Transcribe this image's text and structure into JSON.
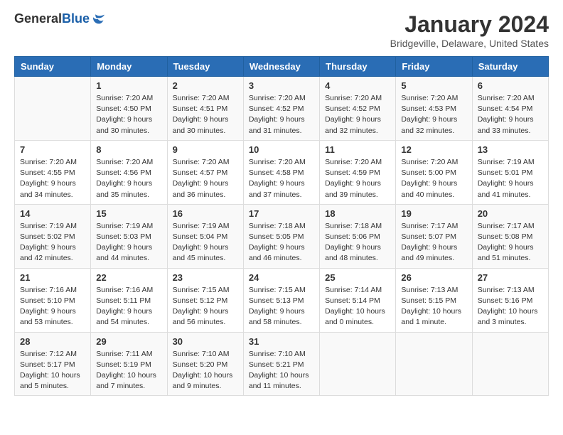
{
  "header": {
    "logo_general": "General",
    "logo_blue": "Blue",
    "month_title": "January 2024",
    "location": "Bridgeville, Delaware, United States"
  },
  "weekdays": [
    "Sunday",
    "Monday",
    "Tuesday",
    "Wednesday",
    "Thursday",
    "Friday",
    "Saturday"
  ],
  "weeks": [
    [
      {
        "day": "",
        "info": ""
      },
      {
        "day": "1",
        "info": "Sunrise: 7:20 AM\nSunset: 4:50 PM\nDaylight: 9 hours\nand 30 minutes."
      },
      {
        "day": "2",
        "info": "Sunrise: 7:20 AM\nSunset: 4:51 PM\nDaylight: 9 hours\nand 30 minutes."
      },
      {
        "day": "3",
        "info": "Sunrise: 7:20 AM\nSunset: 4:52 PM\nDaylight: 9 hours\nand 31 minutes."
      },
      {
        "day": "4",
        "info": "Sunrise: 7:20 AM\nSunset: 4:52 PM\nDaylight: 9 hours\nand 32 minutes."
      },
      {
        "day": "5",
        "info": "Sunrise: 7:20 AM\nSunset: 4:53 PM\nDaylight: 9 hours\nand 32 minutes."
      },
      {
        "day": "6",
        "info": "Sunrise: 7:20 AM\nSunset: 4:54 PM\nDaylight: 9 hours\nand 33 minutes."
      }
    ],
    [
      {
        "day": "7",
        "info": "Sunrise: 7:20 AM\nSunset: 4:55 PM\nDaylight: 9 hours\nand 34 minutes."
      },
      {
        "day": "8",
        "info": "Sunrise: 7:20 AM\nSunset: 4:56 PM\nDaylight: 9 hours\nand 35 minutes."
      },
      {
        "day": "9",
        "info": "Sunrise: 7:20 AM\nSunset: 4:57 PM\nDaylight: 9 hours\nand 36 minutes."
      },
      {
        "day": "10",
        "info": "Sunrise: 7:20 AM\nSunset: 4:58 PM\nDaylight: 9 hours\nand 37 minutes."
      },
      {
        "day": "11",
        "info": "Sunrise: 7:20 AM\nSunset: 4:59 PM\nDaylight: 9 hours\nand 39 minutes."
      },
      {
        "day": "12",
        "info": "Sunrise: 7:20 AM\nSunset: 5:00 PM\nDaylight: 9 hours\nand 40 minutes."
      },
      {
        "day": "13",
        "info": "Sunrise: 7:19 AM\nSunset: 5:01 PM\nDaylight: 9 hours\nand 41 minutes."
      }
    ],
    [
      {
        "day": "14",
        "info": "Sunrise: 7:19 AM\nSunset: 5:02 PM\nDaylight: 9 hours\nand 42 minutes."
      },
      {
        "day": "15",
        "info": "Sunrise: 7:19 AM\nSunset: 5:03 PM\nDaylight: 9 hours\nand 44 minutes."
      },
      {
        "day": "16",
        "info": "Sunrise: 7:19 AM\nSunset: 5:04 PM\nDaylight: 9 hours\nand 45 minutes."
      },
      {
        "day": "17",
        "info": "Sunrise: 7:18 AM\nSunset: 5:05 PM\nDaylight: 9 hours\nand 46 minutes."
      },
      {
        "day": "18",
        "info": "Sunrise: 7:18 AM\nSunset: 5:06 PM\nDaylight: 9 hours\nand 48 minutes."
      },
      {
        "day": "19",
        "info": "Sunrise: 7:17 AM\nSunset: 5:07 PM\nDaylight: 9 hours\nand 49 minutes."
      },
      {
        "day": "20",
        "info": "Sunrise: 7:17 AM\nSunset: 5:08 PM\nDaylight: 9 hours\nand 51 minutes."
      }
    ],
    [
      {
        "day": "21",
        "info": "Sunrise: 7:16 AM\nSunset: 5:10 PM\nDaylight: 9 hours\nand 53 minutes."
      },
      {
        "day": "22",
        "info": "Sunrise: 7:16 AM\nSunset: 5:11 PM\nDaylight: 9 hours\nand 54 minutes."
      },
      {
        "day": "23",
        "info": "Sunrise: 7:15 AM\nSunset: 5:12 PM\nDaylight: 9 hours\nand 56 minutes."
      },
      {
        "day": "24",
        "info": "Sunrise: 7:15 AM\nSunset: 5:13 PM\nDaylight: 9 hours\nand 58 minutes."
      },
      {
        "day": "25",
        "info": "Sunrise: 7:14 AM\nSunset: 5:14 PM\nDaylight: 10 hours\nand 0 minutes."
      },
      {
        "day": "26",
        "info": "Sunrise: 7:13 AM\nSunset: 5:15 PM\nDaylight: 10 hours\nand 1 minute."
      },
      {
        "day": "27",
        "info": "Sunrise: 7:13 AM\nSunset: 5:16 PM\nDaylight: 10 hours\nand 3 minutes."
      }
    ],
    [
      {
        "day": "28",
        "info": "Sunrise: 7:12 AM\nSunset: 5:17 PM\nDaylight: 10 hours\nand 5 minutes."
      },
      {
        "day": "29",
        "info": "Sunrise: 7:11 AM\nSunset: 5:19 PM\nDaylight: 10 hours\nand 7 minutes."
      },
      {
        "day": "30",
        "info": "Sunrise: 7:10 AM\nSunset: 5:20 PM\nDaylight: 10 hours\nand 9 minutes."
      },
      {
        "day": "31",
        "info": "Sunrise: 7:10 AM\nSunset: 5:21 PM\nDaylight: 10 hours\nand 11 minutes."
      },
      {
        "day": "",
        "info": ""
      },
      {
        "day": "",
        "info": ""
      },
      {
        "day": "",
        "info": ""
      }
    ]
  ]
}
